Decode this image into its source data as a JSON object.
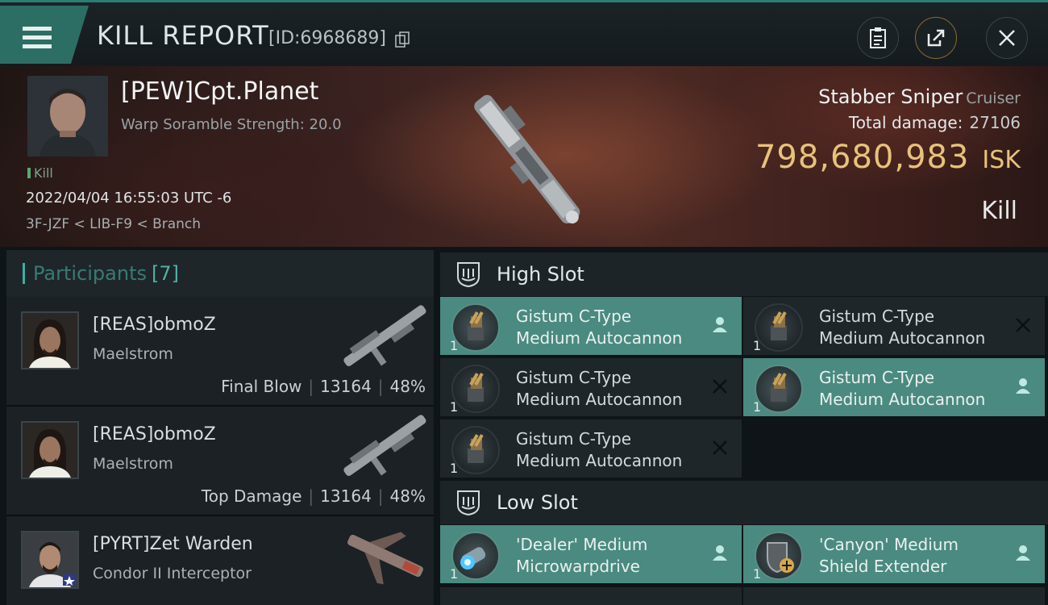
{
  "header": {
    "title": "KILL REPORT",
    "report_id": "[ID:6968689]"
  },
  "victim": {
    "name": "[PEW]Cpt.Planet",
    "subtitle": "Warp Soramble Strength: 20.0",
    "tag": "Kill",
    "datetime": "2022/04/04 16:55:03 UTC -6",
    "location": "3F-JZF < LIB-F9 < Branch",
    "ship_name": "Stabber Sniper",
    "ship_class": "Cruiser",
    "total_damage_label": "Total damage:",
    "total_damage": "27106",
    "isk_value": "798,680,983",
    "isk_unit": "ISK",
    "result": "Kill"
  },
  "participants": {
    "title": "Participants",
    "count": "[7]",
    "rows": [
      {
        "name": "[REAS]obmoZ",
        "ship": "Maelstrom",
        "role": "Final Blow",
        "damage": "13164",
        "percent": "48%"
      },
      {
        "name": "[REAS]obmoZ",
        "ship": "Maelstrom",
        "role": "Top Damage",
        "damage": "13164",
        "percent": "48%"
      },
      {
        "name": "[PYRT]Zet Warden",
        "ship": "Condor II Interceptor"
      }
    ]
  },
  "high_slot": {
    "title": "High Slot",
    "modules": [
      {
        "line1": "Gistum C-Type",
        "line2": "Medium Autocannon",
        "qty": "1",
        "state": "dropped"
      },
      {
        "line1": "Gistum C-Type",
        "line2": "Medium Autocannon",
        "qty": "1",
        "state": "destroyed"
      },
      {
        "line1": "Gistum C-Type",
        "line2": "Medium Autocannon",
        "qty": "1",
        "state": "destroyed"
      },
      {
        "line1": "Gistum C-Type",
        "line2": "Medium Autocannon",
        "qty": "1",
        "state": "dropped"
      },
      {
        "line1": "Gistum C-Type",
        "line2": "Medium Autocannon",
        "qty": "1",
        "state": "destroyed"
      }
    ]
  },
  "low_slot": {
    "title": "Low Slot",
    "modules": [
      {
        "line1": "'Dealer' Medium",
        "line2": "Microwarpdrive",
        "qty": "1",
        "state": "dropped"
      },
      {
        "line1": "'Canyon' Medium",
        "line2": "Shield Extender",
        "qty": "1",
        "state": "dropped"
      }
    ]
  },
  "colors": {
    "accent": "#2c6e64",
    "dropped_bg": "#4a8a80",
    "isk": "#e8c27a"
  },
  "icons": {
    "menu": "hamburger-icon",
    "copy": "copy-icon",
    "clipboard": "clipboard-icon",
    "share": "share-icon",
    "close": "close-icon",
    "slot": "shield-slot-icon",
    "dropped": "person-icon",
    "destroyed": "x-icon"
  }
}
